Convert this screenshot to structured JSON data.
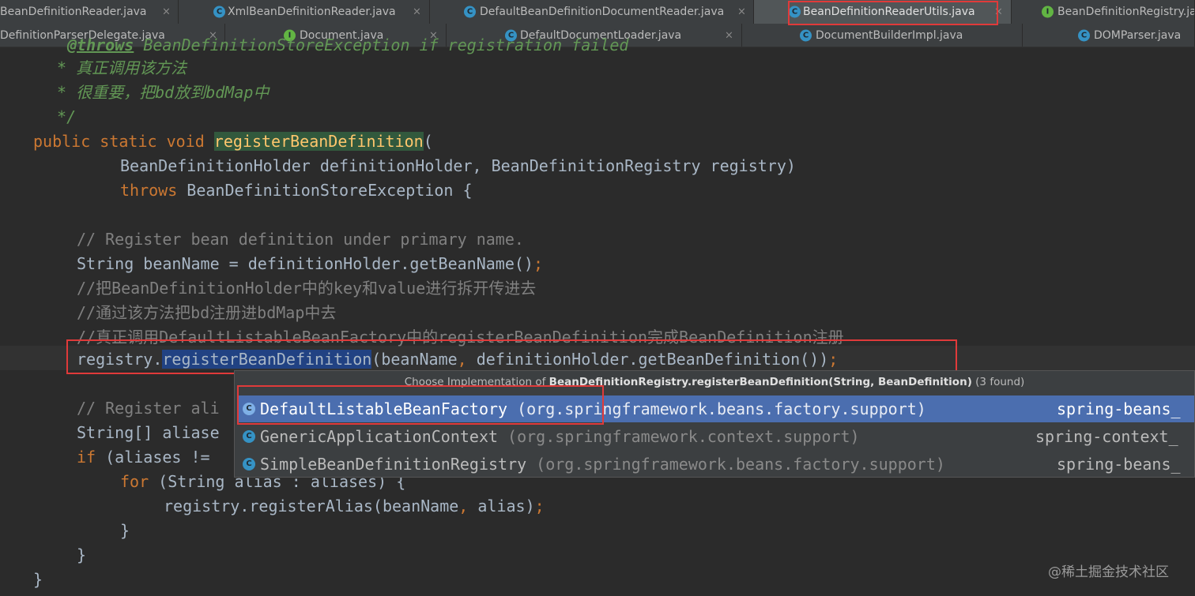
{
  "tabs_row1": [
    {
      "label": "BeanDefinitionReader.java",
      "icon": "",
      "close": "×"
    },
    {
      "label": "XmlBeanDefinitionReader.java",
      "icon": "C",
      "close": "×"
    },
    {
      "label": "DefaultBeanDefinitionDocumentReader.java",
      "icon": "C",
      "close": "×"
    },
    {
      "label": "BeanDefinitionReaderUtils.java",
      "icon": "C",
      "close": "×",
      "active": true
    },
    {
      "label": "BeanDefinitionRegistry.java",
      "icon": "I",
      "close": ""
    }
  ],
  "tabs_row2": [
    {
      "label": "DefinitionParserDelegate.java",
      "icon": "",
      "close": "×"
    },
    {
      "label": "Document.java",
      "icon": "I",
      "close": "×"
    },
    {
      "label": "DefaultDocumentLoader.java",
      "icon": "C",
      "close": "×"
    },
    {
      "label": "DocumentBuilderImpl.java",
      "icon": "C",
      "close": ""
    },
    {
      "label": "DOMParser.java",
      "icon": "C",
      "close": ""
    }
  ],
  "code": {
    "l0_tag": "@throws",
    "l0_rest": " BeanDefinitionStoreException if registration failed",
    "l1": " * 真正调用该方法",
    "l2": " * 很重要，把bd放到bdMap中",
    "l3": " */",
    "l4_kw": "public static void ",
    "l4_method": "registerBeanDefinition",
    "l4_rest": "(",
    "l5": "BeanDefinitionHolder definitionHolder, BeanDefinitionRegistry registry)",
    "l6_kw": "throws",
    "l6_rest": " BeanDefinitionStoreException {",
    "l8": "// Register bean definition under primary name.",
    "l9_a": "String beanName = definitionHolder.getBeanName()",
    "l9_b": ";",
    "l10": "//把BeanDefinitionHolder中的key和value进行拆开传进去",
    "l11": "//通过该方法把bd注册进bdMap中去",
    "l12": "//真正调用DefaultListableBeanFactory中的registerBeanDefinition完成BeanDefinition注册",
    "l13_a": "registry.",
    "l13_sel": "registerBeanDefinition",
    "l13_b": "(beanName",
    "l13_c": ", ",
    "l13_d": "definitionHolder.getBeanDefinition())",
    "l13_e": ";",
    "l15": "// Register ali",
    "l16": "String[] aliase",
    "l17_kw": "if",
    "l17_rest": " (aliases !=",
    "l18_kw": "for",
    "l18_rest": " (String alias : aliases) {",
    "l19_a": "registry.registerAlias(beanName",
    "l19_b": ", ",
    "l19_c": "alias)",
    "l19_d": ";",
    "l20": "}",
    "l21": "}",
    "l22": "}"
  },
  "popup": {
    "prefix": "Choose Implementation of ",
    "method": "BeanDefinitionRegistry.registerBeanDefinition(String, BeanDefinition)",
    "count": " (3 found)",
    "items": [
      {
        "name": "DefaultListableBeanFactory",
        "pkg": "(org.springframework.beans.factory.support)",
        "lib": "spring-beans_",
        "icon": "C"
      },
      {
        "name": "GenericApplicationContext",
        "pkg": "(org.springframework.context.support)",
        "lib": "spring-context_",
        "icon": "C"
      },
      {
        "name": "SimpleBeanDefinitionRegistry",
        "pkg": "(org.springframework.beans.factory.support)",
        "lib": "spring-beans_",
        "icon": "C"
      }
    ]
  },
  "watermark": "@稀土掘金技术社区",
  "colors": {
    "editor_bg": "#2b2b2b",
    "keyword": "#cc7832",
    "comment": "#808080",
    "doc_comment": "#629755",
    "method_decl": "#ffc66d",
    "selection": "#214283",
    "popup_selected": "#4b6eaf",
    "annotation_red": "#e03a3a"
  }
}
